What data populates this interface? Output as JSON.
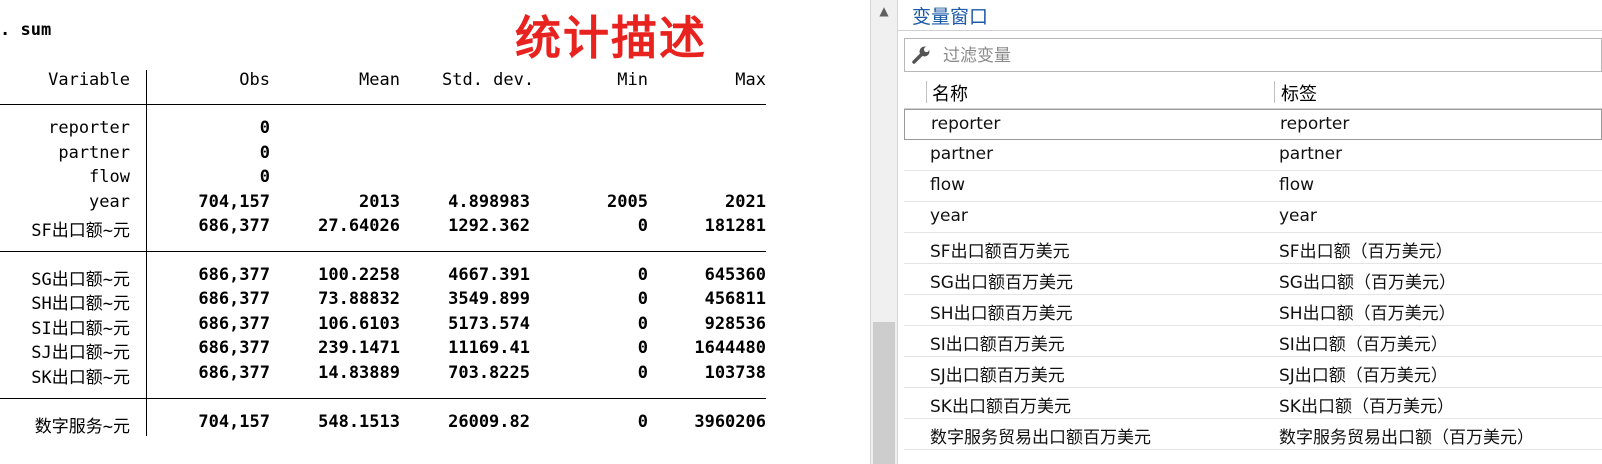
{
  "results": {
    "command": ". sum",
    "title": "统计描述",
    "columns": {
      "variable": "Variable",
      "obs": "Obs",
      "mean": "Mean",
      "sd": "Std. dev.",
      "min": "Min",
      "max": "Max"
    },
    "rows": [
      {
        "name": "reporter",
        "obs": "0",
        "mean": "",
        "sd": "",
        "min": "",
        "max": ""
      },
      {
        "name": "partner",
        "obs": "0",
        "mean": "",
        "sd": "",
        "min": "",
        "max": ""
      },
      {
        "name": "flow",
        "obs": "0",
        "mean": "",
        "sd": "",
        "min": "",
        "max": ""
      },
      {
        "name": "year",
        "obs": "704,157",
        "mean": "2013",
        "sd": "4.898983",
        "min": "2005",
        "max": "2021"
      },
      {
        "name": "SF出口额~元",
        "obs": "686,377",
        "mean": "27.64026",
        "sd": "1292.362",
        "min": "0",
        "max": "181281"
      },
      {
        "name": "SG出口额~元",
        "obs": "686,377",
        "mean": "100.2258",
        "sd": "4667.391",
        "min": "0",
        "max": "645360"
      },
      {
        "name": "SH出口额~元",
        "obs": "686,377",
        "mean": "73.88832",
        "sd": "3549.899",
        "min": "0",
        "max": "456811"
      },
      {
        "name": "SI出口额~元",
        "obs": "686,377",
        "mean": "106.6103",
        "sd": "5173.574",
        "min": "0",
        "max": "928536"
      },
      {
        "name": "SJ出口额~元",
        "obs": "686,377",
        "mean": "239.1471",
        "sd": "11169.41",
        "min": "0",
        "max": "1644480"
      },
      {
        "name": "SK出口额~元",
        "obs": "686,377",
        "mean": "14.83889",
        "sd": "703.8225",
        "min": "0",
        "max": "103738"
      },
      {
        "name": "数字服务~元",
        "obs": "704,157",
        "mean": "548.1513",
        "sd": "26009.82",
        "min": "0",
        "max": "3960206"
      }
    ]
  },
  "variables_window": {
    "title": "变量窗口",
    "filter_placeholder": "过滤变量",
    "col_name": "名称",
    "col_label": "标签",
    "items": [
      {
        "name": "reporter",
        "label": "reporter"
      },
      {
        "name": "partner",
        "label": "partner"
      },
      {
        "name": "flow",
        "label": "flow"
      },
      {
        "name": "year",
        "label": "year"
      },
      {
        "name": "SF出口额百万美元",
        "label": "SF出口额（百万美元）"
      },
      {
        "name": "SG出口额百万美元",
        "label": "SG出口额（百万美元）"
      },
      {
        "name": "SH出口额百万美元",
        "label": "SH出口额（百万美元）"
      },
      {
        "name": "SI出口额百万美元",
        "label": "SI出口额（百万美元）"
      },
      {
        "name": "SJ出口额百万美元",
        "label": "SJ出口额（百万美元）"
      },
      {
        "name": "SK出口额百万美元",
        "label": "SK出口额（百万美元）"
      },
      {
        "name": "数字服务贸易出口额百万美元",
        "label": "数字服务贸易出口额（百万美元）"
      }
    ]
  },
  "colors": {
    "title": "#e8231f",
    "var_title": "#1e5aa8"
  },
  "icons": {
    "filter": "wrench-icon",
    "scroll_up": "arrow-up-icon"
  }
}
